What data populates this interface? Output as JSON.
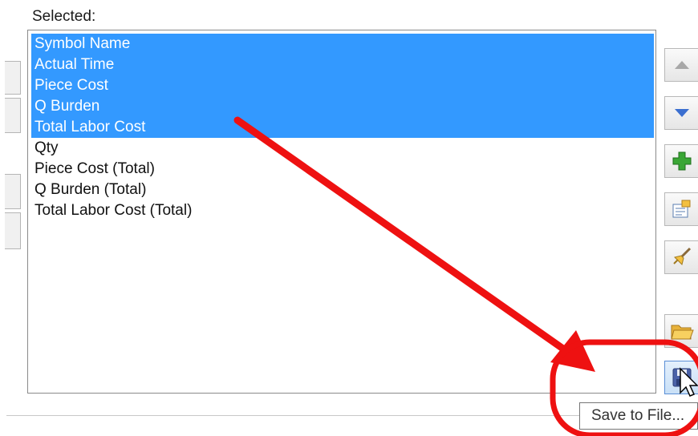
{
  "selected_label": "Selected:",
  "items": [
    {
      "label": "Symbol Name",
      "selected": true
    },
    {
      "label": "Actual Time",
      "selected": true
    },
    {
      "label": "Piece Cost",
      "selected": true
    },
    {
      "label": "Q Burden",
      "selected": true
    },
    {
      "label": "Total Labor Cost",
      "selected": true
    },
    {
      "label": "Qty",
      "selected": false
    },
    {
      "label": "Piece Cost (Total)",
      "selected": false
    },
    {
      "label": "Q Burden (Total)",
      "selected": false
    },
    {
      "label": "Total Labor Cost (Total)",
      "selected": false
    }
  ],
  "side_buttons": [
    "move-up-icon",
    "move-down-icon",
    "add-icon",
    "properties-icon",
    "clear-icon",
    "open-folder-icon",
    "save-disk-icon"
  ],
  "tooltip": "Save to File...",
  "colors": {
    "selection": "#3399ff",
    "annotation": "#ee1111"
  }
}
